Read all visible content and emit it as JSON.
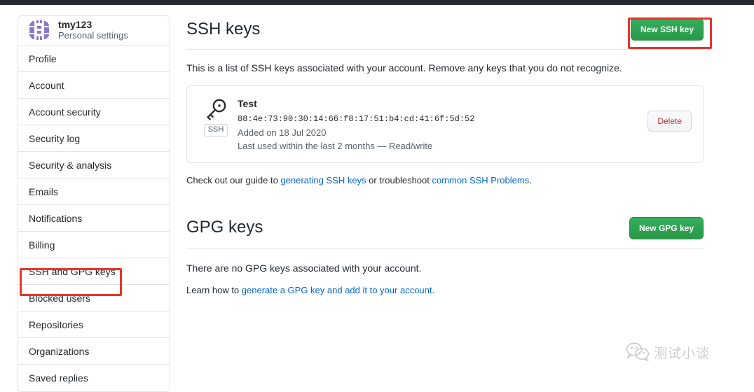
{
  "window": {
    "header_bar_color": "#24292e"
  },
  "sidebar": {
    "profile": {
      "username": "tmy123",
      "subtitle": "Personal settings",
      "avatar_icon": "identicon-avatar",
      "avatar_color": "#8b76c9"
    },
    "items": [
      {
        "label": "Profile",
        "selected": false
      },
      {
        "label": "Account",
        "selected": false
      },
      {
        "label": "Account security",
        "selected": false
      },
      {
        "label": "Security log",
        "selected": false
      },
      {
        "label": "Security & analysis",
        "selected": false
      },
      {
        "label": "Emails",
        "selected": false
      },
      {
        "label": "Notifications",
        "selected": false
      },
      {
        "label": "Billing",
        "selected": false
      },
      {
        "label": "SSH and GPG keys",
        "selected": true
      },
      {
        "label": "Blocked users",
        "selected": false
      },
      {
        "label": "Repositories",
        "selected": false
      },
      {
        "label": "Organizations",
        "selected": false
      },
      {
        "label": "Saved replies",
        "selected": false
      }
    ]
  },
  "ssh_section": {
    "title": "SSH keys",
    "new_key_button": "New SSH key",
    "description": "This is a list of SSH keys associated with your account. Remove any keys that you do not recognize.",
    "keys": [
      {
        "icon": "key-icon",
        "badge": "SSH",
        "title": "Test",
        "fingerprint": "88:4e:73:90:30:14:66:f8:17:51:b4:cd:41:6f:5d:52",
        "added": "Added on 18 Jul 2020",
        "last_used": "Last used within the last 2 months — Read/write",
        "delete_button": "Delete"
      }
    ],
    "help": {
      "prefix": "Check out our guide to ",
      "link1": "generating SSH keys",
      "middle": " or troubleshoot ",
      "link2": "common SSH Problems",
      "suffix": "."
    }
  },
  "gpg_section": {
    "title": "GPG keys",
    "new_key_button": "New GPG key",
    "empty_message": "There are no GPG keys associated with your account.",
    "learn": {
      "prefix": "Learn how to ",
      "link": "generate a GPG key and add it to your account",
      "suffix": "."
    }
  },
  "annotations": {
    "color": "#e8342a",
    "boxes": [
      {
        "target": "new-ssh-key-button"
      },
      {
        "target": "sidebar-item-ssh-and-gpg-keys"
      }
    ]
  },
  "watermark": {
    "icon": "wechat-icon",
    "text": "测试小谈"
  }
}
